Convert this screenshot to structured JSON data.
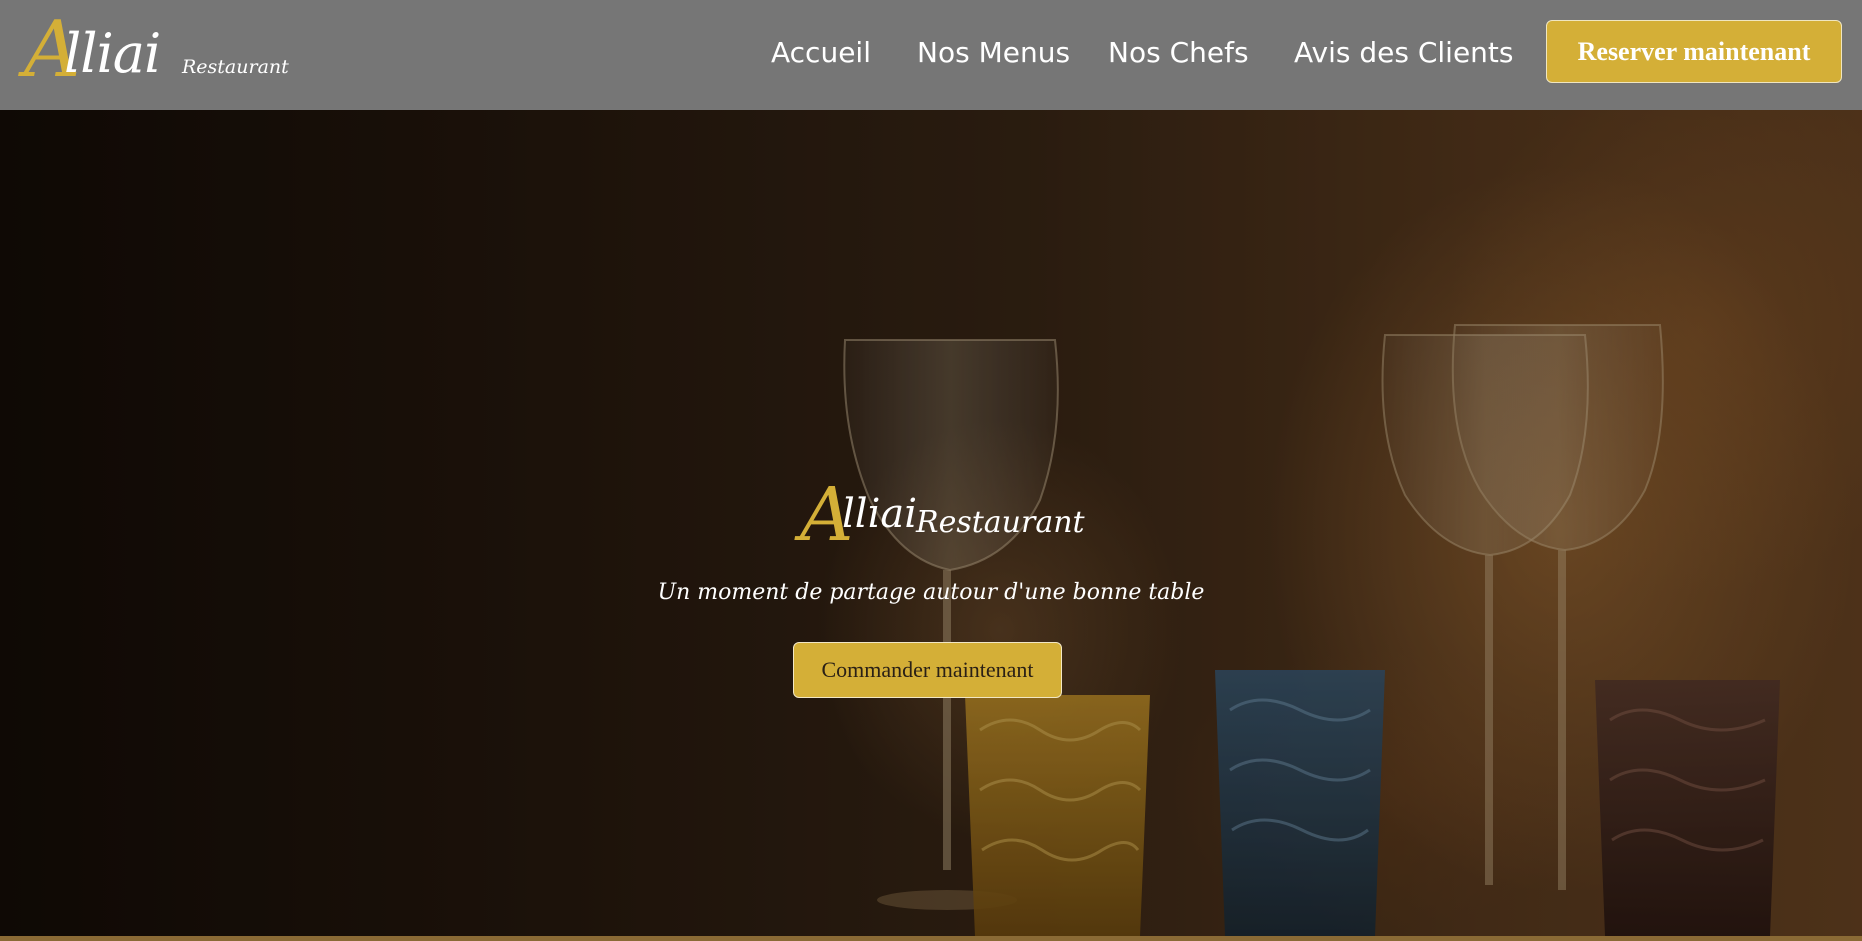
{
  "brand": {
    "logo_initial": "A",
    "logo_name": "lliai",
    "logo_sub": "Restaurant"
  },
  "nav": {
    "items": [
      {
        "label": "Accueil"
      },
      {
        "label": "Nos Menus"
      },
      {
        "label": "Nos Chefs"
      },
      {
        "label": "Avis des Clients"
      }
    ],
    "reserve_label": "Reserver maintenant"
  },
  "hero": {
    "title_initial": "A",
    "title_name": "lliai",
    "title_sub": "Restaurant",
    "tagline": "Un moment de partage autour d'une bonne table",
    "cta_label": "Commander maintenant"
  },
  "colors": {
    "accent": "#d4af37",
    "navbar": "#767676"
  }
}
